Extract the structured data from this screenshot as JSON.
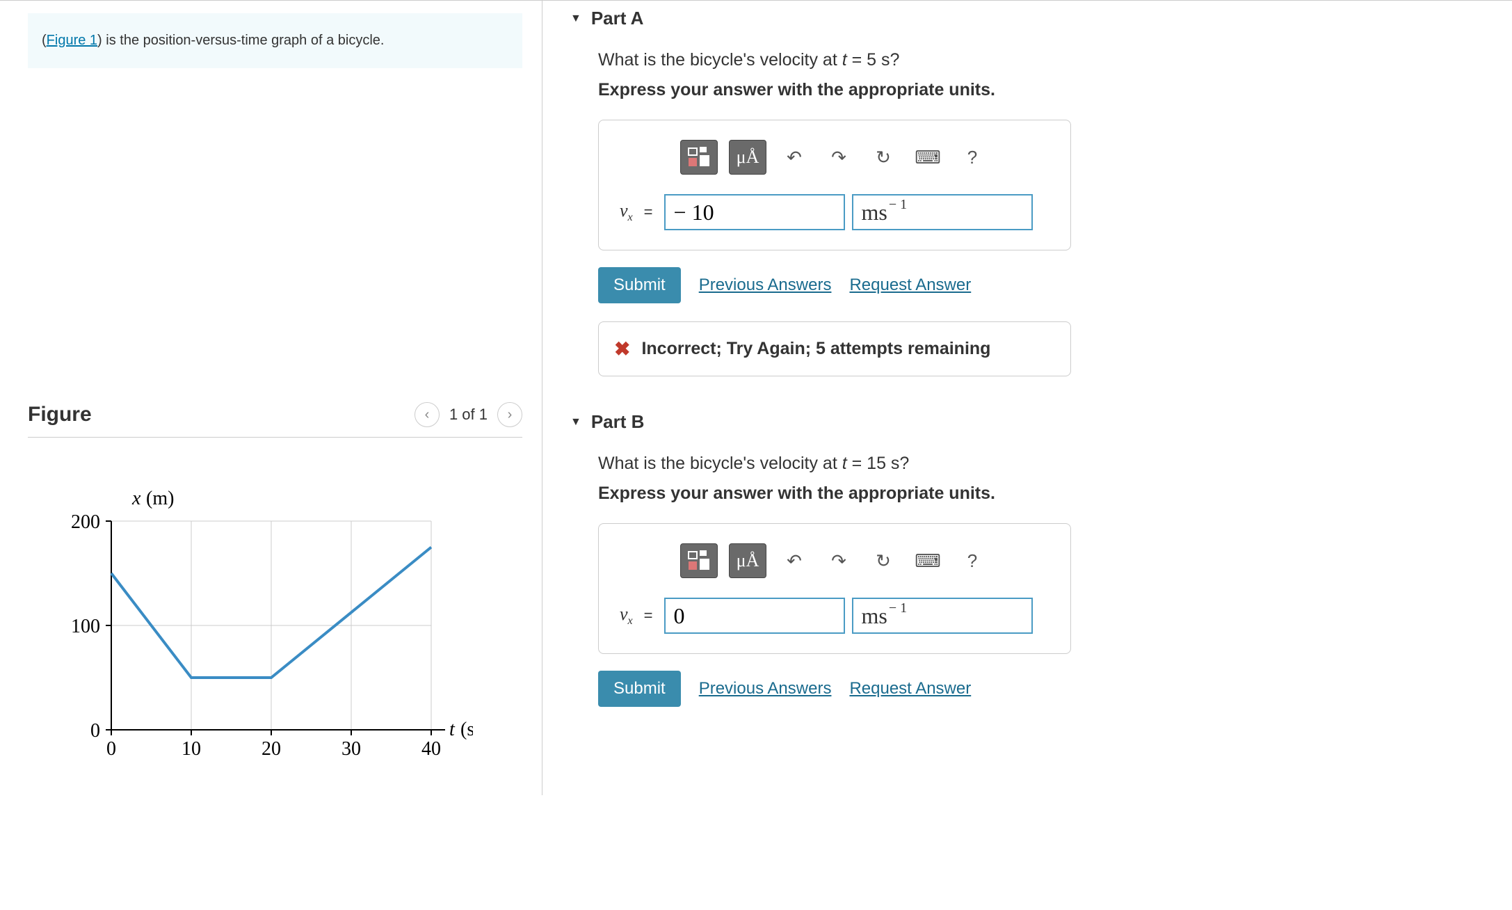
{
  "intro": {
    "figure_link": "Figure 1",
    "rest": ") is the position-versus-time graph of a bicycle."
  },
  "figure": {
    "title": "Figure",
    "counter": "1 of 1"
  },
  "chart_data": {
    "type": "line",
    "title": "",
    "xlabel": "t (s)",
    "ylabel": "x (m)",
    "x": [
      0,
      10,
      20,
      40
    ],
    "y": [
      150,
      50,
      50,
      175
    ],
    "xlim": [
      0,
      40
    ],
    "ylim": [
      0,
      200
    ],
    "xticks": [
      0,
      10,
      20,
      30,
      40
    ],
    "yticks": [
      0,
      100,
      200
    ],
    "grid": true
  },
  "partA": {
    "title": "Part A",
    "question": "What is the bicycle's velocity at t = 5 s?",
    "instruction": "Express your answer with the appropriate units.",
    "var": "v",
    "var_sub": "x",
    "value": "− 10",
    "unit": "ms",
    "unit_exp": "− 1",
    "submit": "Submit",
    "prev": "Previous Answers",
    "request": "Request Answer",
    "feedback": "Incorrect; Try Again; 5 attempts remaining"
  },
  "partB": {
    "title": "Part B",
    "question": "What is the bicycle's velocity at t = 15 s?",
    "instruction": "Express your answer with the appropriate units.",
    "var": "v",
    "var_sub": "x",
    "value": "0",
    "unit": "ms",
    "unit_exp": "− 1",
    "submit": "Submit",
    "prev": "Previous Answers",
    "request": "Request Answer"
  },
  "toolbar": {
    "templates": "templates",
    "units_btn": "μÅ",
    "undo": "↶",
    "redo": "↷",
    "reset": "↻",
    "keyboard": "⌨",
    "help": "?"
  }
}
